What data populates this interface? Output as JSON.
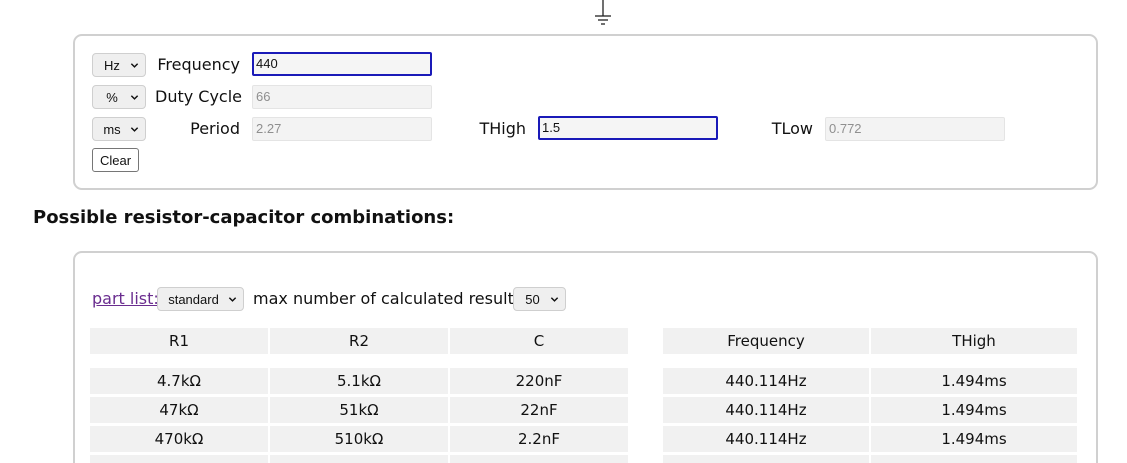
{
  "calculator": {
    "rows": [
      {
        "unit": "Hz",
        "label": "Frequency",
        "value": "440",
        "active": true
      },
      {
        "unit": "%",
        "label": "Duty Cycle",
        "placeholder": "66"
      },
      {
        "unit": "ms",
        "label": "Period",
        "placeholder": "2.27"
      }
    ],
    "thigh": {
      "label": "THigh",
      "value": "1.5"
    },
    "tlow": {
      "label": "TLow",
      "placeholder": "0.772"
    },
    "clear_label": "Clear"
  },
  "results": {
    "heading": "Possible resistor-capacitor combinations:",
    "part_list_label": "part list:",
    "part_list_value": "standard",
    "max_results_label": "max number of calculated results:",
    "max_results_value": "50",
    "columns": [
      "R1",
      "R2",
      "C",
      "Frequency",
      "THigh"
    ],
    "rows": [
      [
        "4.7kΩ",
        "5.1kΩ",
        "220nF",
        "440.114Hz",
        "1.494ms"
      ],
      [
        "47kΩ",
        "51kΩ",
        "22nF",
        "440.114Hz",
        "1.494ms"
      ],
      [
        "470kΩ",
        "510kΩ",
        "2.2nF",
        "440.114Hz",
        "1.494ms"
      ]
    ]
  },
  "icons": {
    "ground": "ground-symbol-icon",
    "dropdown": "chevron-down-icon"
  }
}
